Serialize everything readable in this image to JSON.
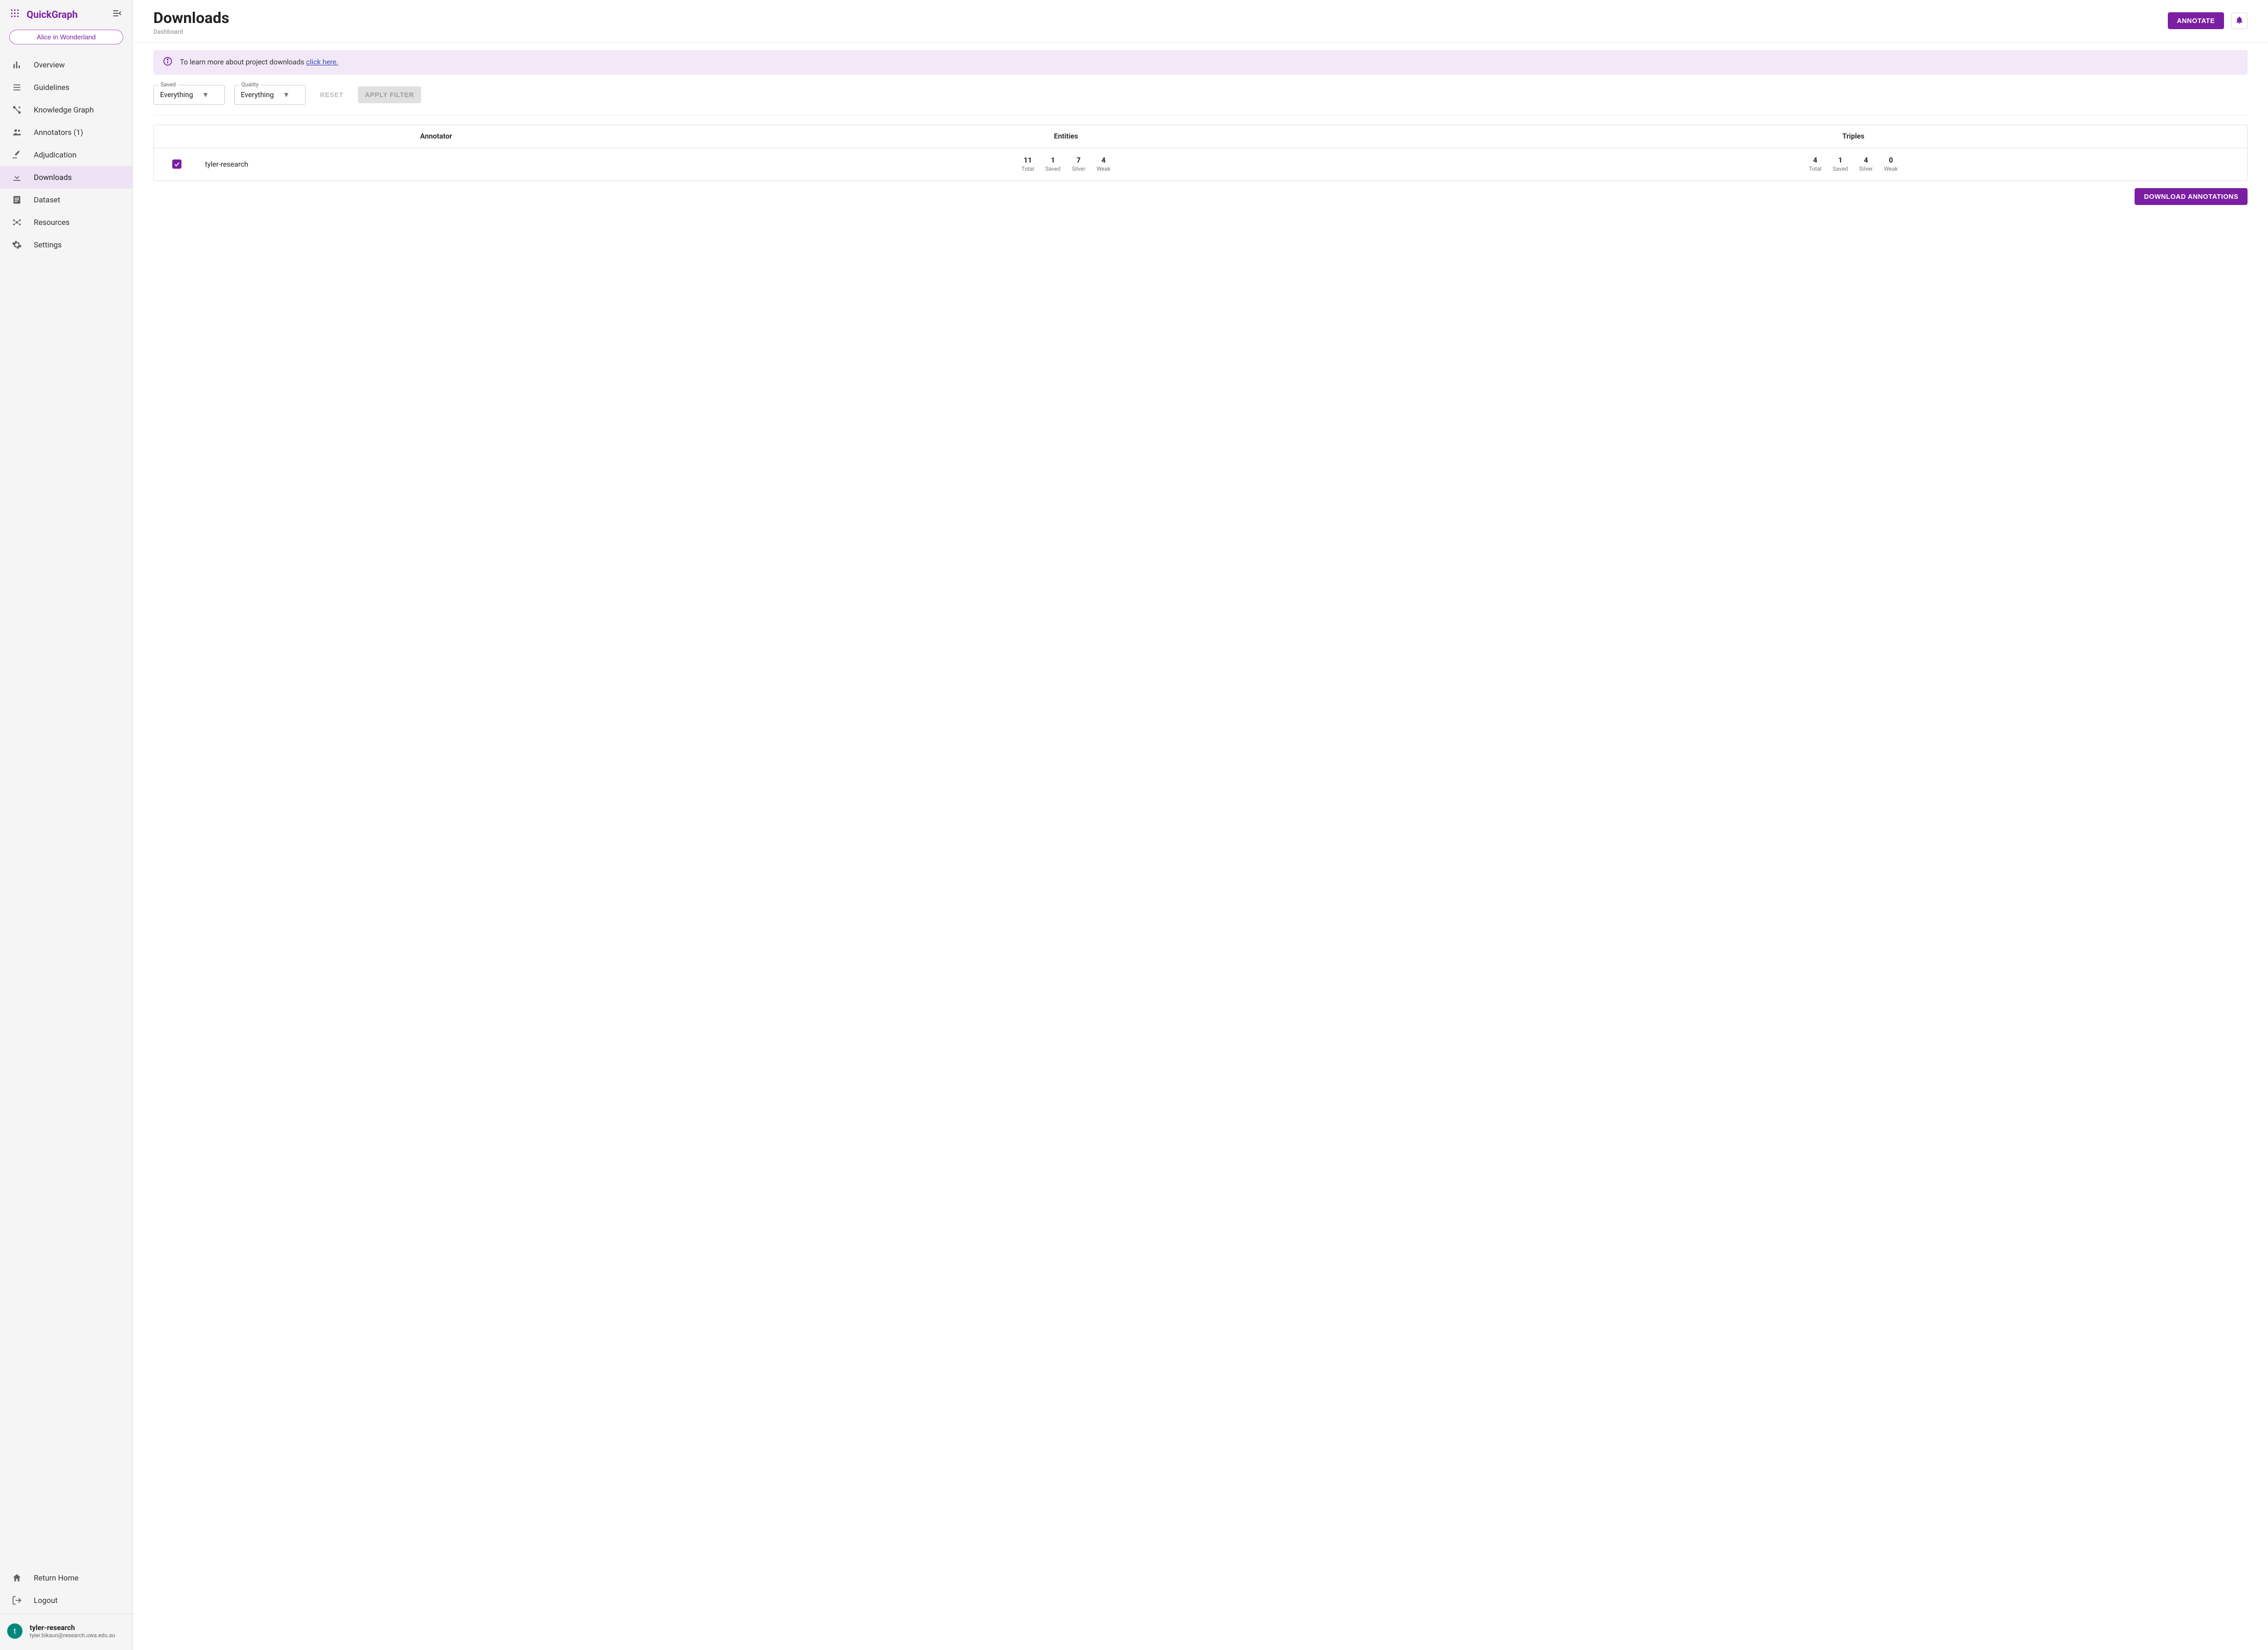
{
  "brand": {
    "name": "QuickGraph"
  },
  "project_chip": "Alice in Wonderland",
  "sidebar": {
    "items": [
      {
        "label": "Overview"
      },
      {
        "label": "Guidelines"
      },
      {
        "label": "Knowledge Graph"
      },
      {
        "label": "Annotators (1)"
      },
      {
        "label": "Adjudication"
      },
      {
        "label": "Downloads"
      },
      {
        "label": "Dataset"
      },
      {
        "label": "Resources"
      },
      {
        "label": "Settings"
      }
    ],
    "footer": [
      {
        "label": "Return Home"
      },
      {
        "label": "Logout"
      }
    ]
  },
  "user": {
    "initial": "t",
    "name": "tyler-research",
    "email": "tyler.bikaun@research.uwa.edu.au"
  },
  "header": {
    "title": "Downloads",
    "breadcrumb": "Dashboard",
    "annotate_btn": "ANNOTATE"
  },
  "banner": {
    "text": "To learn more about project downloads ",
    "link_text": "click here."
  },
  "filters": {
    "saved": {
      "label": "Saved",
      "value": "Everything"
    },
    "quality": {
      "label": "Quality",
      "value": "Everything"
    },
    "reset": "RESET",
    "apply": "APPLY FILTER"
  },
  "table": {
    "headers": {
      "annotator": "Annotator",
      "entities": "Entities",
      "triples": "Triples"
    },
    "stat_labels": {
      "total": "Total",
      "saved": "Saved",
      "silver": "Silver",
      "weak": "Weak"
    },
    "rows": [
      {
        "checked": true,
        "annotator": "tyler-research",
        "entities": {
          "total": "11",
          "saved": "1",
          "silver": "7",
          "weak": "4"
        },
        "triples": {
          "total": "4",
          "saved": "1",
          "silver": "4",
          "weak": "0"
        }
      }
    ]
  },
  "download_btn": "DOWNLOAD ANNOTATIONS"
}
